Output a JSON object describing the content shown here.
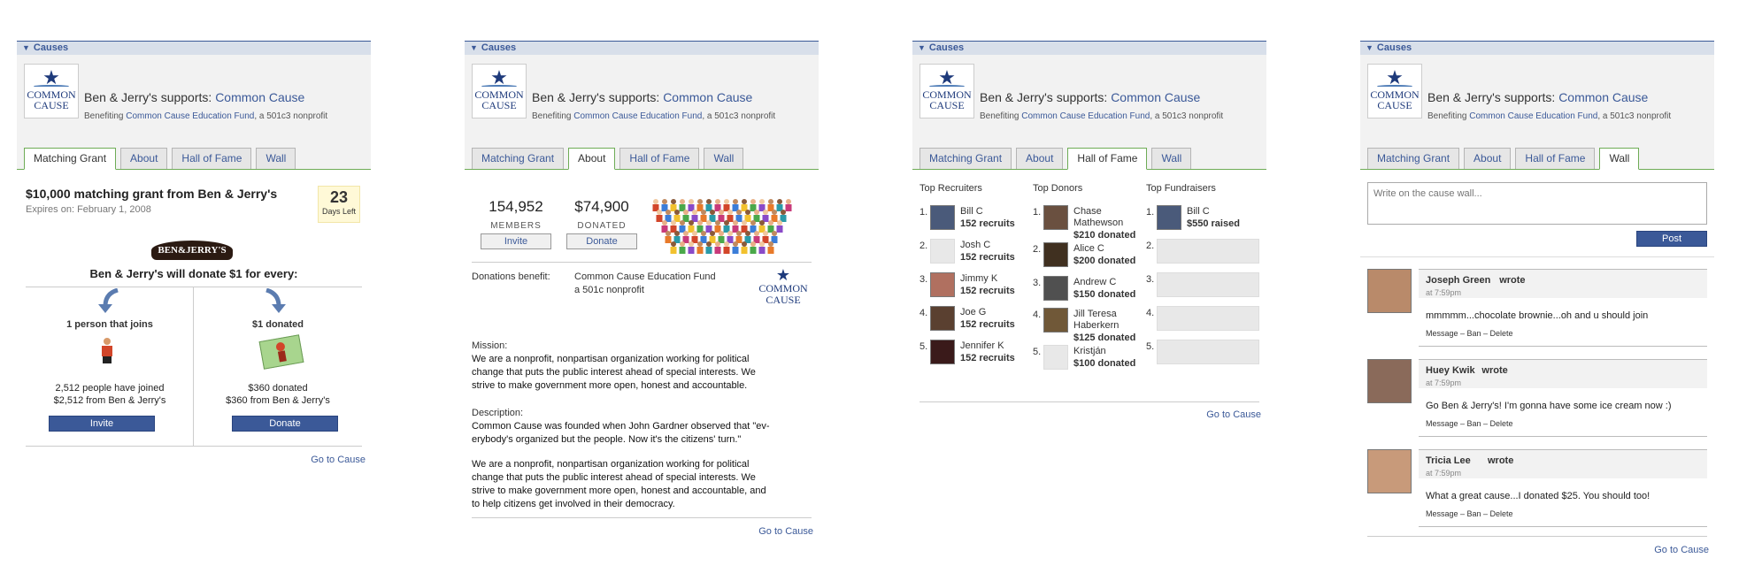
{
  "common": {
    "causes_bar": "Causes",
    "supporter": "Ben & Jerry's supports:",
    "cause_name": "Common Cause",
    "benefiting_prefix": "Benefiting",
    "fund_name": "Common Cause Education Fund",
    "benefiting_suffix": ", a 501c3 nonprofit",
    "logo_line1": "COMMON",
    "logo_line2": "CAUSE",
    "tabs": [
      "Matching Grant",
      "About",
      "Hall of Fame",
      "Wall"
    ],
    "go_to_cause": "Go to Cause"
  },
  "grant": {
    "title": "$10,000 matching grant from Ben & Jerry's",
    "expires": "Expires on: February 1, 2008",
    "days_num": "23",
    "days_label": "Days Left",
    "brand_logo": "BEN&JERRY'S",
    "donate_line": "Ben & Jerry's will donate $1 for every:",
    "left_title": "1 person that joins",
    "left_stat1": "2,512 people have joined",
    "left_stat2": "$2,512 from Ben & Jerry's",
    "left_button": "Invite",
    "right_title": "$1 donated",
    "right_stat1": "$360 donated",
    "right_stat2": "$360 from Ben & Jerry's",
    "right_button": "Donate"
  },
  "about": {
    "members_num": "154,952",
    "members_label": "MEMBERS",
    "donated_num": "$74,900",
    "donated_label": "DONATED",
    "invite": "Invite",
    "donate": "Donate",
    "donations_benefit_label": "Donations benefit:",
    "fund_name": "Common Cause Education Fund",
    "fund_type": "a 501c nonprofit",
    "mission_label": "Mission:",
    "mission_lines": [
      "We are a nonprofit, nonpartisan organization working for political",
      "change that puts the public interest ahead of special interests. We",
      "strive to make government more open, honest and accountable."
    ],
    "description_label": "Description:",
    "description_lines": [
      "Common Cause was founded when John Gardner observed that \"ev-",
      "erybody's organized but the people. Now it's the citizens' turn.\""
    ],
    "extra_lines": [
      "We are a nonprofit, nonpartisan organization working for political",
      "change that puts the public interest ahead of special interests. We",
      "strive to make government more open, honest and accountable, and",
      "to help citizens get involved in their democracy."
    ]
  },
  "hall": {
    "recruiters_title": "Top Recruiters",
    "donors_title": "Top Donors",
    "fundraisers_title": "Top Fundraisers",
    "recruiters": [
      {
        "n": "1.",
        "name": "Bill C",
        "stat": "152 recruits"
      },
      {
        "n": "2.",
        "name": "Josh C",
        "stat": "152 recruits"
      },
      {
        "n": "3.",
        "name": "Jimmy K",
        "stat": "152 recruits"
      },
      {
        "n": "4.",
        "name": "Joe G",
        "stat": "152 recruits"
      },
      {
        "n": "5.",
        "name": "Jennifer K",
        "stat": "152 recruits"
      }
    ],
    "donors": [
      {
        "n": "1.",
        "name": "Chase",
        "name2": "Mathewson",
        "stat": "$210 donated"
      },
      {
        "n": "2.",
        "name": "Alice C",
        "name2": "",
        "stat": "$200 donated"
      },
      {
        "n": "3.",
        "name": "Andrew C",
        "name2": "",
        "stat": "$150 donated"
      },
      {
        "n": "4.",
        "name": "Jill Teresa",
        "name2": "Haberkern",
        "stat": "$125 donated"
      },
      {
        "n": "5.",
        "name": "Kristján",
        "name2": "",
        "stat": "$100 donated"
      }
    ],
    "fundraisers": [
      {
        "n": "1.",
        "name": "Bill C",
        "stat": "$550 raised"
      },
      {
        "n": "2.",
        "name": "",
        "stat": ""
      },
      {
        "n": "3.",
        "name": "",
        "stat": ""
      },
      {
        "n": "4.",
        "name": "",
        "stat": ""
      },
      {
        "n": "5.",
        "name": "",
        "stat": ""
      }
    ]
  },
  "wall": {
    "placeholder": "Write on the cause wall...",
    "post": "Post",
    "posts": [
      {
        "name": "Joseph Green",
        "wrote": "wrote",
        "time": "at 7:59pm",
        "text": "mmmmm...chocolate brownie...oh and u should join",
        "actions": "Message – Ban – Delete"
      },
      {
        "name": "Huey Kwik",
        "wrote": "wrote",
        "time": "at 7:59pm",
        "text": "Go Ben & Jerry's! I'm gonna have some ice cream now :)",
        "actions": "Message – Ban – Delete"
      },
      {
        "name": "Tricia Lee",
        "wrote": "wrote",
        "time": "at 7:59pm",
        "text": "What a great cause...I donated $25. You should too!",
        "actions": "Message – Ban – Delete"
      }
    ]
  }
}
